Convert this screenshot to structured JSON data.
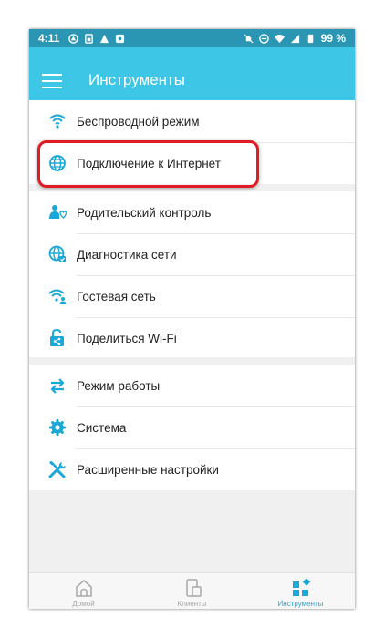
{
  "status_bar": {
    "time": "4:11",
    "battery": "99 %"
  },
  "appbar": {
    "title": "Инструменты"
  },
  "menu": {
    "group1": [
      {
        "label": "Беспроводной режим",
        "icon": "wifi-icon"
      },
      {
        "label": "Подключение к Интернет",
        "icon": "globe-icon"
      }
    ],
    "group2": [
      {
        "label": "Родительский контроль",
        "icon": "parental-control-icon"
      },
      {
        "label": "Диагностика сети",
        "icon": "network-diagnostics-icon"
      },
      {
        "label": "Гостевая сеть",
        "icon": "guest-wifi-icon"
      },
      {
        "label": "Поделиться Wi-Fi",
        "icon": "share-wifi-icon"
      }
    ],
    "group3": [
      {
        "label": "Режим работы",
        "icon": "operation-mode-icon"
      },
      {
        "label": "Система",
        "icon": "gear-icon"
      },
      {
        "label": "Расширенные настройки",
        "icon": "tools-icon"
      }
    ]
  },
  "bottom_nav": [
    {
      "label": "Домой",
      "icon": "home-icon",
      "active": false
    },
    {
      "label": "Клиенты",
      "icon": "devices-icon",
      "active": false
    },
    {
      "label": "Инструменты",
      "icon": "tools-grid-icon",
      "active": true
    }
  ],
  "colors": {
    "accent": "#3ec6e6",
    "icon_blue": "#1aa8d8",
    "highlight": "#e01b24"
  }
}
